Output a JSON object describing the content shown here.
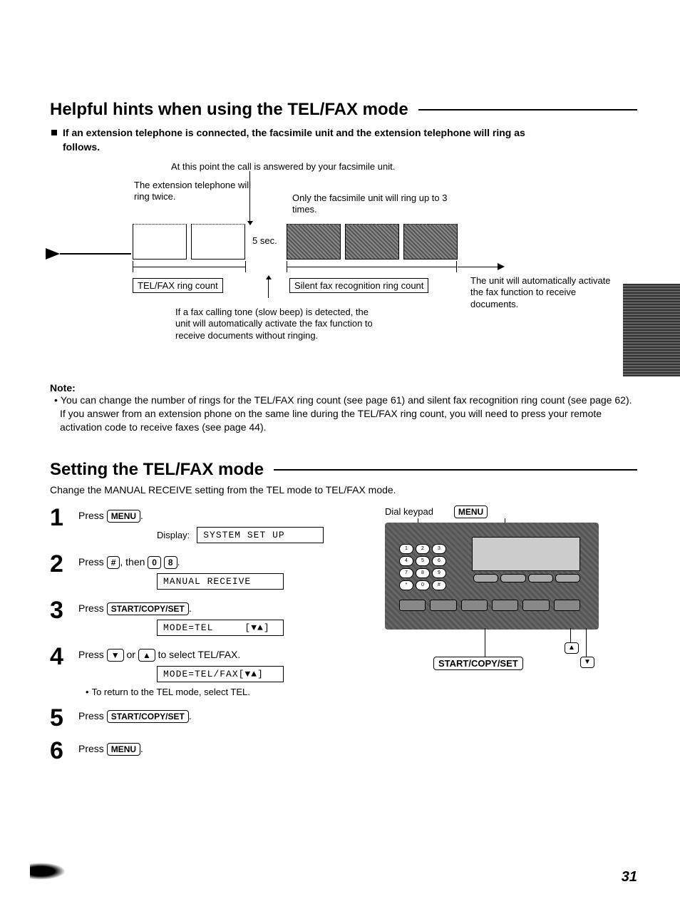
{
  "heading1": "Helpful hints when using the TEL/FAX mode",
  "intro_bullet": "If an extension telephone is connected, the facsimile unit and the extension telephone will ring as",
  "intro_follows": "follows.",
  "diagram": {
    "top_line": "At this point the call is answered by your facsimile unit.",
    "ext_ring": "The extension telephone will ring twice.",
    "only_fax": "Only the facsimile unit will ring up to 3 times.",
    "five_sec": "5 sec.",
    "telfax_ring_count": "TEL/FAX ring count",
    "silent_count": "Silent fax recognition ring count",
    "auto_activate": "The unit will automatically activate the fax function to receive documents.",
    "fax_tone_note": "If a fax calling tone (slow beep) is detected, the unit will automatically activate the fax function to receive documents without ringing."
  },
  "note_h": "Note:",
  "note_body": "You can change the number of rings for the TEL/FAX ring count (see page 61) and silent fax recognition ring count (see page 62). If you answer from an extension phone on the same line during the TEL/FAX ring count, you will need to press your remote activation code to receive faxes (see page 44).",
  "heading2": "Setting the TEL/FAX mode",
  "change_line": "Change the MANUAL RECEIVE setting from the TEL mode to TEL/FAX mode.",
  "keys": {
    "menu": "MENU",
    "hash": "#",
    "zero": "0",
    "eight": "8",
    "start": "START/COPY/SET",
    "down": "▼",
    "up": "▲"
  },
  "steps": {
    "s1_text_a": "Press ",
    "s1_text_b": ".",
    "display_label": "Display:",
    "s1_lcd": "SYSTEM SET UP",
    "s2_a": "Press ",
    "s2_b": ", then ",
    "s2_c": ".",
    "s2_lcd": "MANUAL RECEIVE",
    "s3_a": "Press ",
    "s3_b": ".",
    "s3_lcd": "MODE=TEL     [▼▲]",
    "s4_a": "Press ",
    "s4_b": " or ",
    "s4_c": " to select TEL/FAX.",
    "s4_lcd": "MODE=TEL/FAX[▼▲]",
    "s4_sub": "To return to the TEL mode, select TEL.",
    "s5_a": "Press ",
    "s5_b": ".",
    "s6_a": "Press ",
    "s6_b": "."
  },
  "panel": {
    "dial_keypad": "Dial keypad",
    "menu": "MENU",
    "start": "START/COPY/SET"
  },
  "page_number": "31"
}
